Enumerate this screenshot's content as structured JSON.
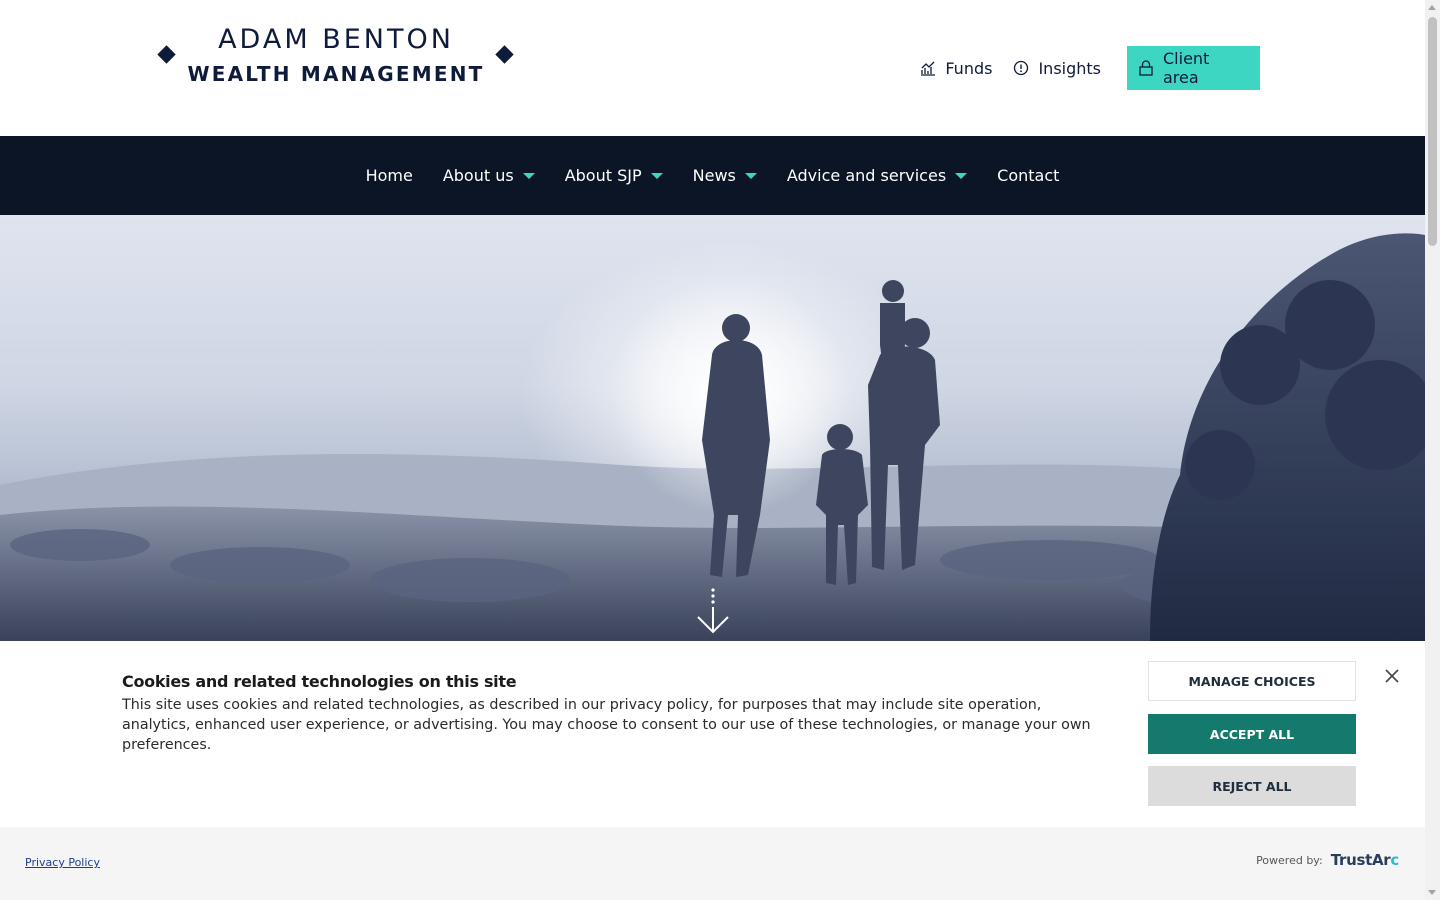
{
  "brand": {
    "line1": "ADAM BENTON",
    "line2": "WEALTH MANAGEMENT",
    "color": "#0f1b3a"
  },
  "top_links": {
    "funds": {
      "label": "Funds",
      "icon": "chart-icon"
    },
    "insights": {
      "label": "Insights",
      "icon": "alert-circle-icon"
    },
    "client": {
      "label": "Client area",
      "icon": "lock-icon",
      "color": "#3dd6c2"
    }
  },
  "nav": {
    "background": "#0b1526",
    "caret_color": "#3dd6c2",
    "items": [
      {
        "label": "Home",
        "has_dropdown": false
      },
      {
        "label": "About us",
        "has_dropdown": true
      },
      {
        "label": "About SJP",
        "has_dropdown": true
      },
      {
        "label": "News",
        "has_dropdown": true
      },
      {
        "label": "Advice and services",
        "has_dropdown": true
      },
      {
        "label": "Contact",
        "has_dropdown": false
      }
    ]
  },
  "hero": {
    "scroll_icon": "arrow-down-icon"
  },
  "cookie_banner": {
    "title": "Cookies and related technologies on this site",
    "text": "This site uses cookies and related technologies, as described in our privacy policy, for purposes that may include site operation, analytics, enhanced user experience, or advertising. You may choose to consent to our use of these technologies, or manage your own preferences.",
    "manage_label": "MANAGE CHOICES",
    "accept_label": "ACCEPT ALL",
    "reject_label": "REJECT ALL",
    "accept_color": "#137a6d",
    "close_icon": "close-icon"
  },
  "cookie_footer": {
    "privacy_link": "Privacy Policy",
    "powered_by": "Powered by:",
    "brand_main": "TrustAr",
    "brand_end": "c"
  }
}
